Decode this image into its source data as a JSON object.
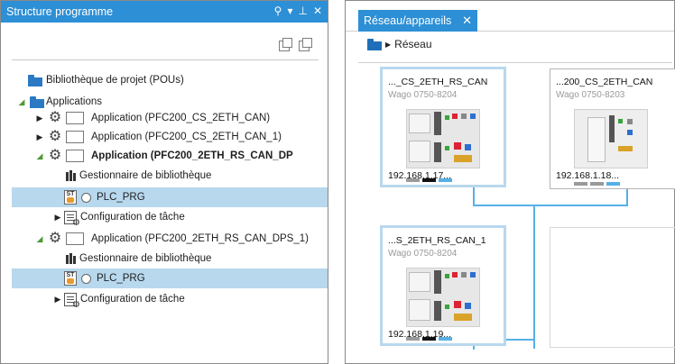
{
  "left_panel": {
    "title": "Structure programme",
    "tree": {
      "project_library": "Bibliothèque de projet (POUs)",
      "applications_root": "Applications",
      "apps": [
        {
          "label": "Application (PFC200_CS_2ETH_CAN)"
        },
        {
          "label": "Application (PFC200_CS_2ETH_CAN_1)"
        },
        {
          "label": "Application (PFC200_2ETH_RS_CAN_DP",
          "library_manager": "Gestionnaire de bibliothèque",
          "program": "PLC_PRG",
          "task_config": "Configuration de tâche"
        },
        {
          "label": "Application (PFC200_2ETH_RS_CAN_DPS_1)",
          "library_manager": "Gestionnaire de bibliothèque",
          "program": "PLC_PRG",
          "task_config": "Configuration de tâche"
        }
      ]
    }
  },
  "right_panel": {
    "tab": "Réseau/appareils",
    "breadcrumb": "Réseau",
    "devices": [
      {
        "name": "..._CS_2ETH_RS_CAN",
        "type": "Wago 0750-8204",
        "ip": "192.168.1.17..."
      },
      {
        "name": "...200_CS_2ETH_CAN",
        "type": "Wago 0750-8203",
        "ip": "192.168.1.18..."
      },
      {
        "name": "...S_2ETH_RS_CAN_1",
        "type": "Wago 0750-8204",
        "ip": "192.168.1.19..."
      }
    ]
  },
  "colors": {
    "accent": "#2d8fd5",
    "selection": "#b8d8ee",
    "network_link": "#56b0e6",
    "port_gray": "#9a9a9a",
    "port_black": "#111111",
    "port_blue": "#56b0e6"
  }
}
